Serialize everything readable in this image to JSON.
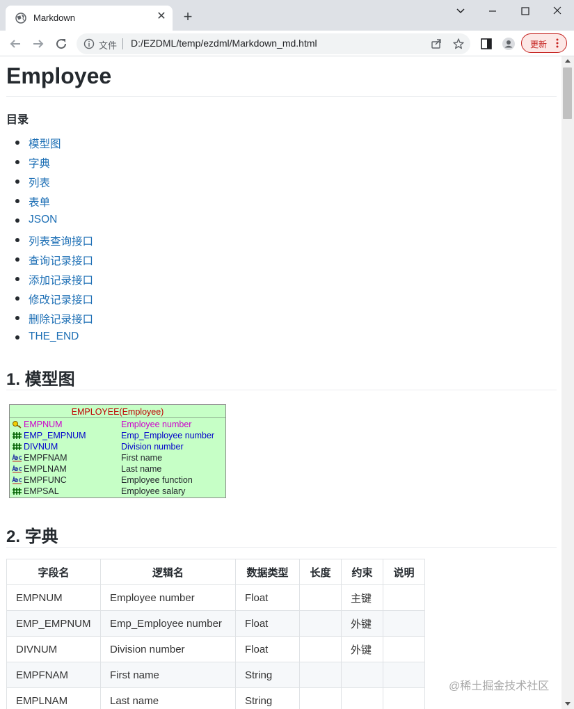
{
  "browser": {
    "tab_title": "Markdown",
    "omnibox_file_label": "文件",
    "url": "D:/EZDML/temp/ezdml/Markdown_md.html",
    "update_label": "更新"
  },
  "page": {
    "title": "Employee",
    "toc_title": "目录",
    "toc": [
      "模型图",
      "字典",
      "列表",
      "表单",
      "JSON",
      "列表查询接口",
      "查询记录接口",
      "添加记录接口",
      "修改记录接口",
      "删除记录接口",
      "THE_END"
    ],
    "section1": {
      "num": "1.",
      "title": "模型图"
    },
    "section2": {
      "num": "2.",
      "title": "字典"
    }
  },
  "diagram": {
    "title": "EMPLOYEE(Employee)",
    "rows": [
      {
        "name": "EMPNUM",
        "label": "Employee number",
        "icon": "key-icon",
        "color": "#cc00cc"
      },
      {
        "name": "EMP_EMPNUM",
        "label": "Emp_Employee number",
        "icon": "number-icon",
        "color": "#0000cc"
      },
      {
        "name": "DIVNUM",
        "label": "Division number",
        "icon": "number-icon",
        "color": "#0000cc"
      },
      {
        "name": "EMPFNAM",
        "label": "First name",
        "icon": "text-icon",
        "color": "#000000"
      },
      {
        "name": "EMPLNAM",
        "label": "Last name",
        "icon": "text-icon",
        "color": "#000000"
      },
      {
        "name": "EMPFUNC",
        "label": "Employee function",
        "icon": "text-icon",
        "color": "#000000"
      },
      {
        "name": "EMPSAL",
        "label": "Employee salary",
        "icon": "number-icon",
        "color": "#000000"
      }
    ]
  },
  "dictionary": {
    "headers": [
      "字段名",
      "逻辑名",
      "数据类型",
      "长度",
      "约束",
      "说明"
    ],
    "rows": [
      [
        "EMPNUM",
        "Employee number",
        "Float",
        "",
        "主键",
        ""
      ],
      [
        "EMP_EMPNUM",
        "Emp_Employee number",
        "Float",
        "",
        "外键",
        ""
      ],
      [
        "DIVNUM",
        "Division number",
        "Float",
        "",
        "外键",
        ""
      ],
      [
        "EMPFNAM",
        "First name",
        "String",
        "",
        "",
        ""
      ],
      [
        "EMPLNAM",
        "Last name",
        "String",
        "",
        "",
        ""
      ]
    ]
  },
  "watermark": "@稀土掘金技术社区"
}
